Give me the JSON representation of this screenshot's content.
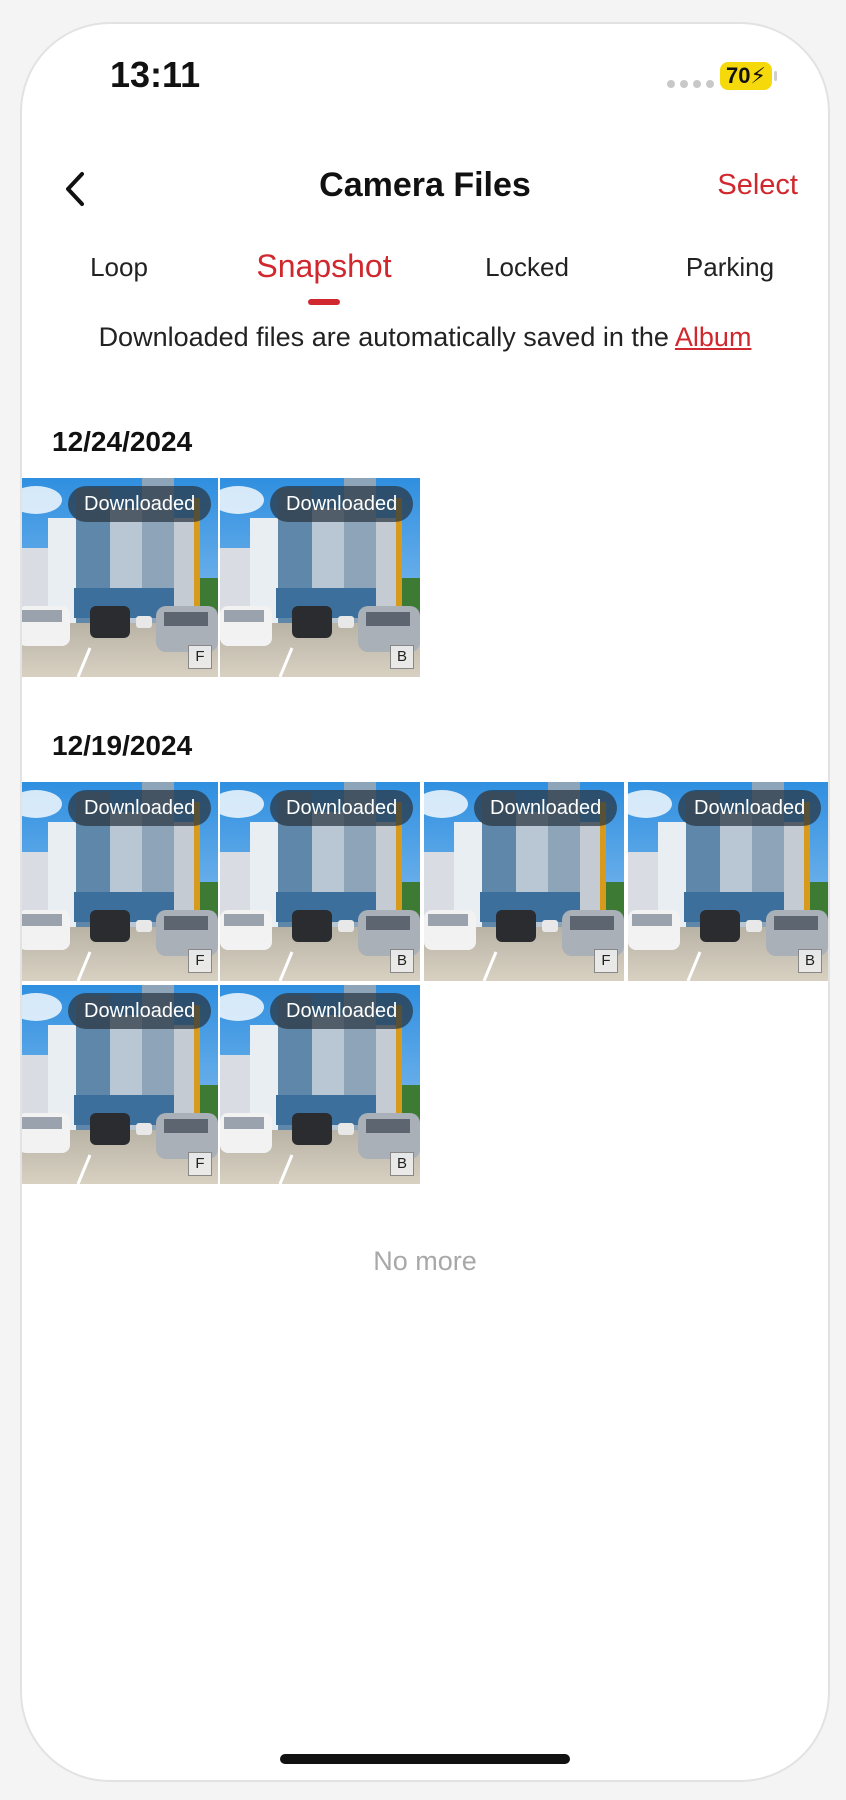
{
  "status_bar": {
    "time": "13:11",
    "battery": "70⚡"
  },
  "header": {
    "title": "Camera Files",
    "select_label": "Select"
  },
  "tabs": [
    {
      "label": "Loop"
    },
    {
      "label": "Snapshot"
    },
    {
      "label": "Locked"
    },
    {
      "label": "Parking"
    }
  ],
  "active_tab": "Snapshot",
  "notice": {
    "text": "Downloaded files are automatically saved in the",
    "link": "Album"
  },
  "groups": [
    {
      "date": "12/24/2024",
      "items": [
        {
          "status": "Downloaded",
          "camera": "F"
        },
        {
          "status": "Downloaded",
          "camera": "B"
        }
      ]
    },
    {
      "date": "12/19/2024",
      "items": [
        {
          "status": "Downloaded",
          "camera": "F"
        },
        {
          "status": "Downloaded",
          "camera": "B"
        },
        {
          "status": "Downloaded",
          "camera": "F"
        },
        {
          "status": "Downloaded",
          "camera": "B"
        },
        {
          "status": "Downloaded",
          "camera": "F"
        },
        {
          "status": "Downloaded",
          "camera": "B"
        }
      ]
    }
  ],
  "footer": {
    "no_more": "No more"
  },
  "colors": {
    "accent": "#d0282e",
    "battery": "#f5d90a"
  },
  "icons": {
    "back": "chevron-left-icon",
    "thumbnail": "dashcam-snapshot-image"
  }
}
